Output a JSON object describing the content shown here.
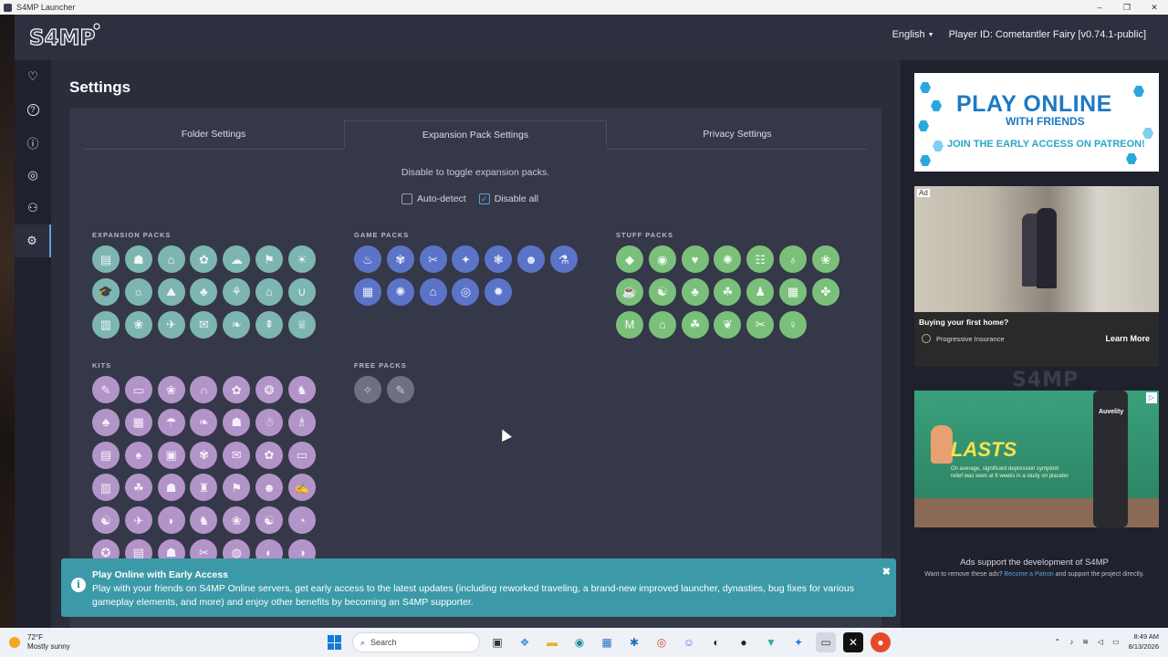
{
  "window": {
    "title": "S4MP Launcher",
    "controls": [
      "–",
      "❐",
      "✕"
    ]
  },
  "header": {
    "logo": "S4MP",
    "language": "English",
    "player_id": "Player ID: Cometantler Fairy [v0.74.1-public]"
  },
  "sidebar": {
    "items": [
      {
        "icon": "♡",
        "name": "favorites"
      },
      {
        "icon": "?",
        "name": "help"
      },
      {
        "icon": "ⓘ",
        "name": "info"
      },
      {
        "icon": "◎",
        "name": "web"
      },
      {
        "icon": "⚇",
        "name": "friends"
      },
      {
        "icon": "⚙",
        "name": "settings"
      }
    ]
  },
  "main": {
    "title": "Settings",
    "tabs": [
      {
        "label": "Folder Settings",
        "active": false
      },
      {
        "label": "Expansion Pack Settings",
        "active": true
      },
      {
        "label": "Privacy Settings",
        "active": false
      }
    ],
    "hint": "Disable to toggle expansion packs.",
    "auto_detect_label": "Auto-detect",
    "auto_detect_checked": false,
    "disable_all_label": "Disable all",
    "disable_all_checked": true,
    "sections": {
      "expansion_packs": "EXPANSION PACKS",
      "game_packs": "GAME PACKS",
      "stuff_packs": "STUFF PACKS",
      "kits": "KITS",
      "free_packs": "FREE PACKS"
    },
    "pack_glyphs": {
      "expansion": [
        "▤",
        "☗",
        "⌂",
        "✿",
        "☁",
        "⚑",
        "☀",
        "🎓",
        "☼",
        "⛰",
        "♣",
        "⚘",
        "⌂",
        "∪",
        "▥",
        "❀",
        "✈",
        "✉",
        "❧",
        "⇞",
        "♕"
      ],
      "game": [
        "♨",
        "✾",
        "✂",
        "✦",
        "❃",
        "☻",
        "⚗",
        "▦",
        "✺",
        "⌂",
        "◎",
        "✹"
      ],
      "stuff": [
        "◆",
        "◉",
        "♥",
        "✺",
        "☷",
        "♁",
        "❀",
        "☕",
        "☯",
        "♣",
        "☘",
        "♟",
        "▦",
        "✤",
        "M",
        "⌂",
        "☘",
        "❦",
        "✂",
        "♀"
      ],
      "kits": [
        "✎",
        "▭",
        "❀",
        "∩",
        "✿",
        "❂",
        "♞",
        "♣",
        "▦",
        "☂",
        "❧",
        "☗",
        "☃",
        "♗",
        "▤",
        "♠",
        "▣",
        "✾",
        "✉",
        "✿",
        "▭",
        "▥",
        "☘",
        "☗",
        "♜",
        "⚑",
        "☻",
        "✍",
        "☯",
        "✈",
        "◗",
        "♞",
        "❀",
        "☯",
        "◔",
        "✪",
        "▤",
        "☗",
        "✂",
        "◍",
        "◐",
        "◑",
        "♡",
        "♨",
        "✂",
        "▩",
        "▥",
        "▧",
        "☂"
      ],
      "free": [
        "✧",
        "✎"
      ]
    }
  },
  "banner": {
    "title": "Play Online with Early Access",
    "text": "Play with your friends on S4MP Online servers, get early access to the latest updates (including reworked traveling, a brand-new improved launcher, dynasties, bug fixes for various gameplay elements, and more) and enjoy other benefits by becoming an S4MP supporter.",
    "close": "✖"
  },
  "ads": {
    "ad1": {
      "line1": "PLAY ONLINE",
      "line2": "WITH FRIENDS",
      "line3": "JOIN THE EARLY ACCESS ON PATREON!"
    },
    "ad2": {
      "tag": "Ad",
      "headline": "Buying your first home?",
      "advertiser": "Progressive Insurance",
      "cta": "Learn More"
    },
    "mid_logo": "S4MP",
    "ad3": {
      "headline": "LASTS",
      "fine": "On average, significant depression symptom relief was seen at 6 weeks in a study on placebo",
      "brand": "Auvelity"
    },
    "note": "Ads support the development of S4MP",
    "note2_pre": "Want to remove these ads?",
    "note2_link": "Become a Patron",
    "note2_post": "and support the project directly."
  },
  "taskbar": {
    "temp": "72°F",
    "weather": "Mostly sunny",
    "search_placeholder": "Search",
    "time": "8:49 AM",
    "date": "8/13/2026"
  },
  "colors": {
    "accent": "#5aa2d6",
    "expansion": "#7db6b0",
    "game": "#5b74c8",
    "stuff": "#7bc07a",
    "kits": "#b394c8",
    "banner": "#3c9aa8"
  }
}
